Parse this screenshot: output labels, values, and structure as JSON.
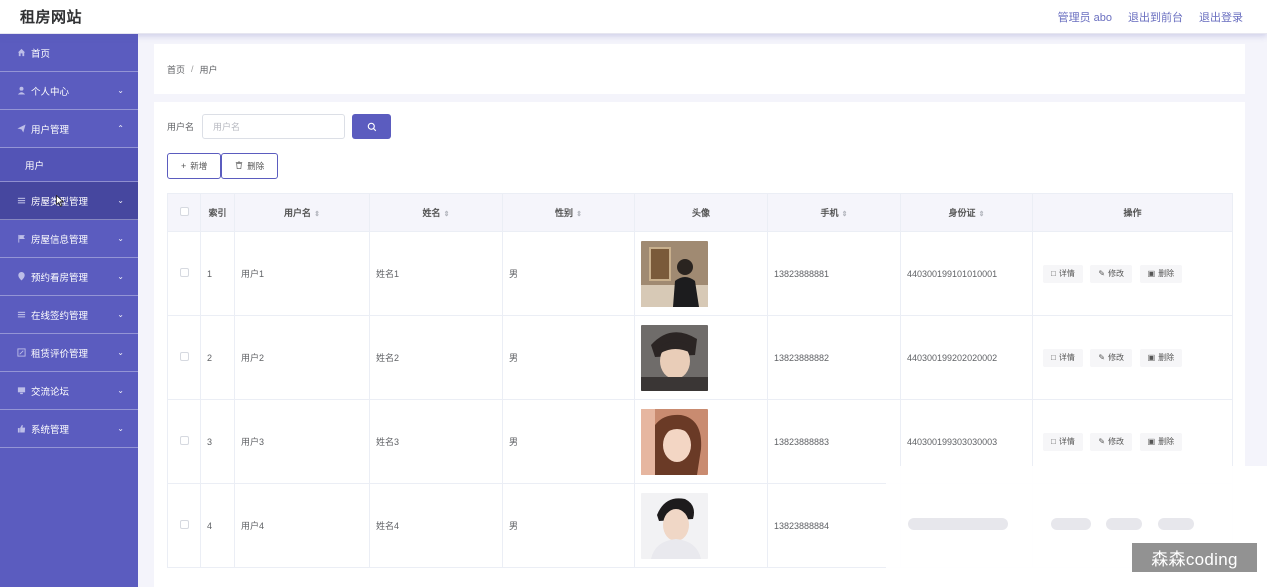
{
  "header": {
    "brand": "租房网站",
    "admin_label": "管理员 abo",
    "back_to_front": "退出到前台",
    "logout": "退出登录"
  },
  "sidebar": {
    "items": [
      {
        "label": "首页",
        "icon": "home-icon",
        "has_chevron": false
      },
      {
        "label": "个人中心",
        "icon": "user-icon",
        "has_chevron": true,
        "chevron": "down"
      },
      {
        "label": "用户管理",
        "icon": "send-icon",
        "has_chevron": true,
        "chevron": "up",
        "expanded": true,
        "children": [
          {
            "label": "用户"
          }
        ]
      },
      {
        "label": "房屋类型管理",
        "icon": "list-icon",
        "has_chevron": true,
        "chevron": "down",
        "hovered": true
      },
      {
        "label": "房屋信息管理",
        "icon": "flag-icon",
        "has_chevron": true,
        "chevron": "down"
      },
      {
        "label": "预约看房管理",
        "icon": "location-icon",
        "has_chevron": true,
        "chevron": "down"
      },
      {
        "label": "在线签约管理",
        "icon": "list-icon",
        "has_chevron": true,
        "chevron": "down"
      },
      {
        "label": "租赁评价管理",
        "icon": "edit-icon",
        "has_chevron": true,
        "chevron": "down"
      },
      {
        "label": "交流论坛",
        "icon": "monitor-icon",
        "has_chevron": true,
        "chevron": "down"
      },
      {
        "label": "系统管理",
        "icon": "thumb-icon",
        "has_chevron": true,
        "chevron": "down"
      }
    ]
  },
  "breadcrumb": {
    "home": "首页",
    "separator": "/",
    "current": "用户"
  },
  "search": {
    "label": "用户名",
    "placeholder": "用户名",
    "value": ""
  },
  "toolbar": {
    "add_label": "新增",
    "delete_label": "删除"
  },
  "table": {
    "columns": [
      "索引",
      "用户名",
      "姓名",
      "性别",
      "头像",
      "手机",
      "身份证",
      "操作"
    ],
    "sortable": [
      false,
      true,
      true,
      true,
      false,
      true,
      true,
      false
    ],
    "rows": [
      {
        "index": "1",
        "username": "用户1",
        "name": "姓名1",
        "gender": "男",
        "phone": "13823888881",
        "id_card": "440300199101010001"
      },
      {
        "index": "2",
        "username": "用户2",
        "name": "姓名2",
        "gender": "男",
        "phone": "13823888882",
        "id_card": "440300199202020002"
      },
      {
        "index": "3",
        "username": "用户3",
        "name": "姓名3",
        "gender": "男",
        "phone": "13823888883",
        "id_card": "440300199303030003"
      },
      {
        "index": "4",
        "username": "用户4",
        "name": "姓名4",
        "gender": "男",
        "phone": "13823888884",
        "id_card": ""
      }
    ],
    "actions": {
      "detail": "详情",
      "edit": "修改",
      "delete": "删除"
    }
  },
  "watermark": "森森coding",
  "colors": {
    "primary": "#5b5cbf",
    "sidebar": "#5b5cbf",
    "header_bg": "#ffffff"
  }
}
